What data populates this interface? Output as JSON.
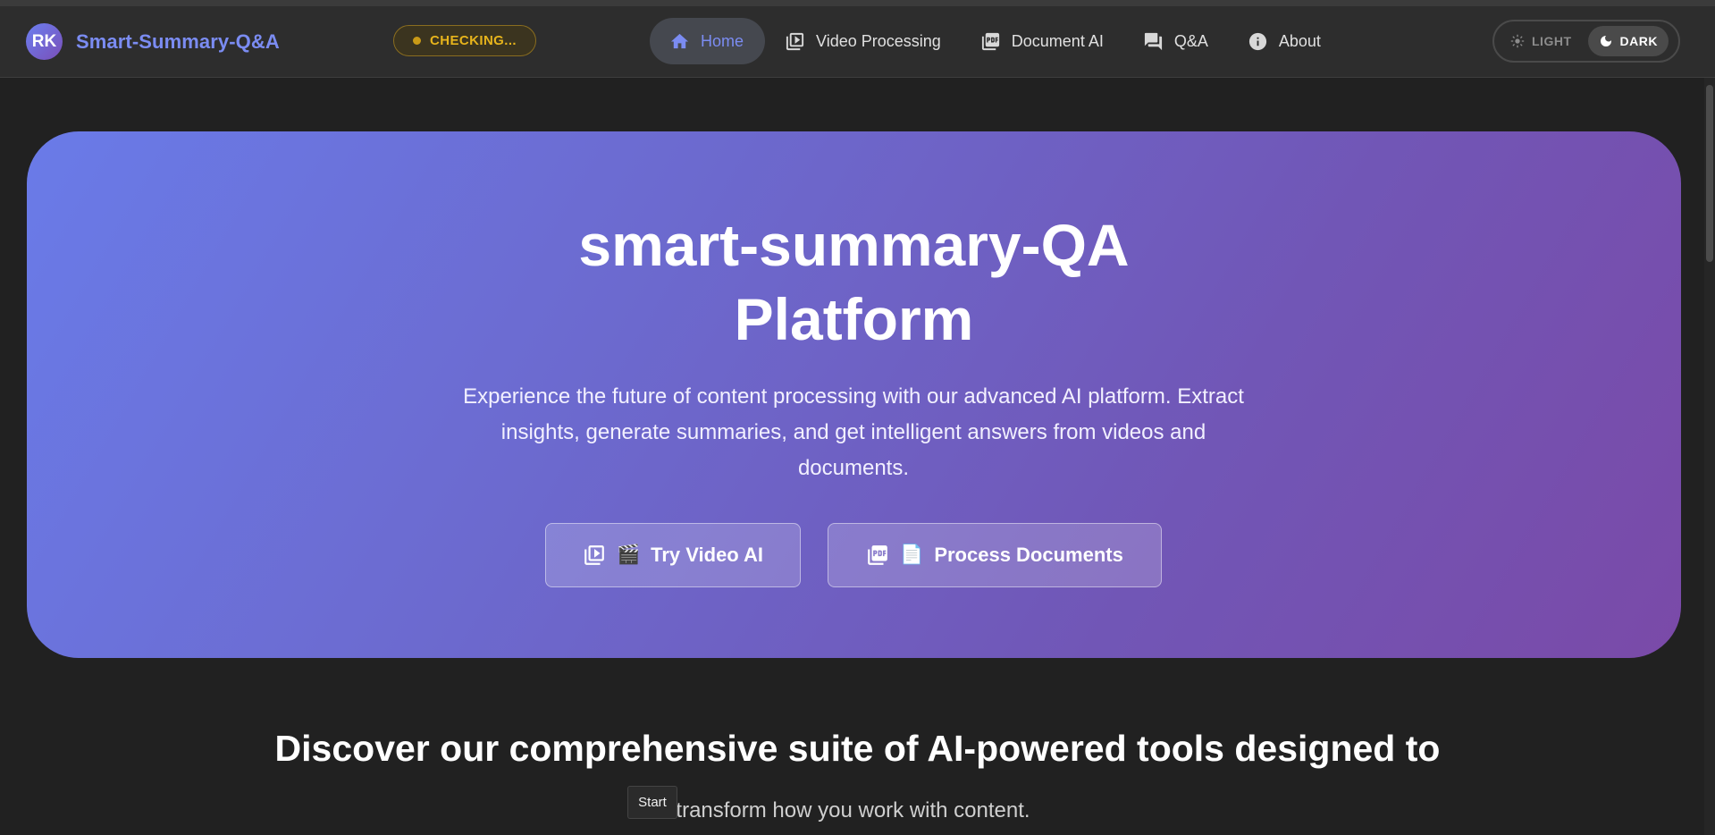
{
  "header": {
    "logo_initials": "RK",
    "brand_name": "Smart-Summary-Q&A",
    "status_label": "CHECKING...",
    "nav": {
      "home": "Home",
      "video": "Video Processing",
      "document": "Document AI",
      "qa": "Q&A",
      "about": "About"
    },
    "active_nav": "Home",
    "theme": {
      "light_label": "LIGHT",
      "dark_label": "DARK",
      "selected": "DARK"
    }
  },
  "hero": {
    "title_line1": "smart-summary-QA",
    "title_line2": "Platform",
    "subtitle": "Experience the future of content processing with our advanced AI platform. Extract insights, generate summaries, and get intelligent answers from videos and documents.",
    "buttons": {
      "video_emoji": "🎬",
      "video_label": "Try Video AI",
      "docs_emoji": "📄",
      "docs_label": "Process Documents"
    }
  },
  "features": {
    "heading": "Discover our comprehensive suite of AI-powered tools designed to",
    "subheading": "transform how you work with content."
  },
  "tooltip": {
    "text": "Start"
  },
  "colors": {
    "background": "#212121",
    "header": "#2d2d2d",
    "accent": "#7b8cf2",
    "status": "#e7b41c",
    "hero_start": "#6a7be8",
    "hero_end": "#7a4aa8"
  },
  "icons": {
    "home": "home-icon",
    "video": "video-library-icon",
    "document": "pdf-icon",
    "qa": "chat-bubbles-icon",
    "about": "info-icon",
    "light": "sun-icon",
    "dark": "moon-icon"
  }
}
